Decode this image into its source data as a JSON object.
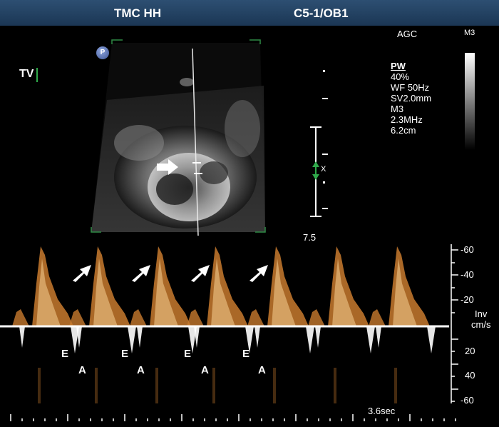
{
  "header": {
    "hospital": "TMC HH",
    "probe": "C5-1/OB1"
  },
  "agc_label": "AGC",
  "map_label": "M3",
  "view_label": "TV",
  "p_icon_label": "P",
  "gate_marker": "X",
  "params": [
    "PW",
    "40%",
    "WF 50Hz",
    "SV2.0mm",
    "M3",
    "2.3MHz",
    "6.2cm"
  ],
  "depth_value": "7.5",
  "time_scale": "3.6sec",
  "velocity_unit": [
    "Inv",
    "cm/s"
  ],
  "velocity_scale": {
    "upper": [
      "-60",
      "-40",
      "-20"
    ],
    "lower": [
      "20",
      "40",
      "-60"
    ]
  },
  "doppler": {
    "labels": [
      "E",
      "A",
      "E",
      "A",
      "E",
      "A",
      "E",
      "A"
    ]
  },
  "colors": {
    "header_bg": "#1e3a5a",
    "doppler_trace": "#c87a2e",
    "baseline": "#ffffff",
    "gate_marker": "#2fa84a"
  }
}
